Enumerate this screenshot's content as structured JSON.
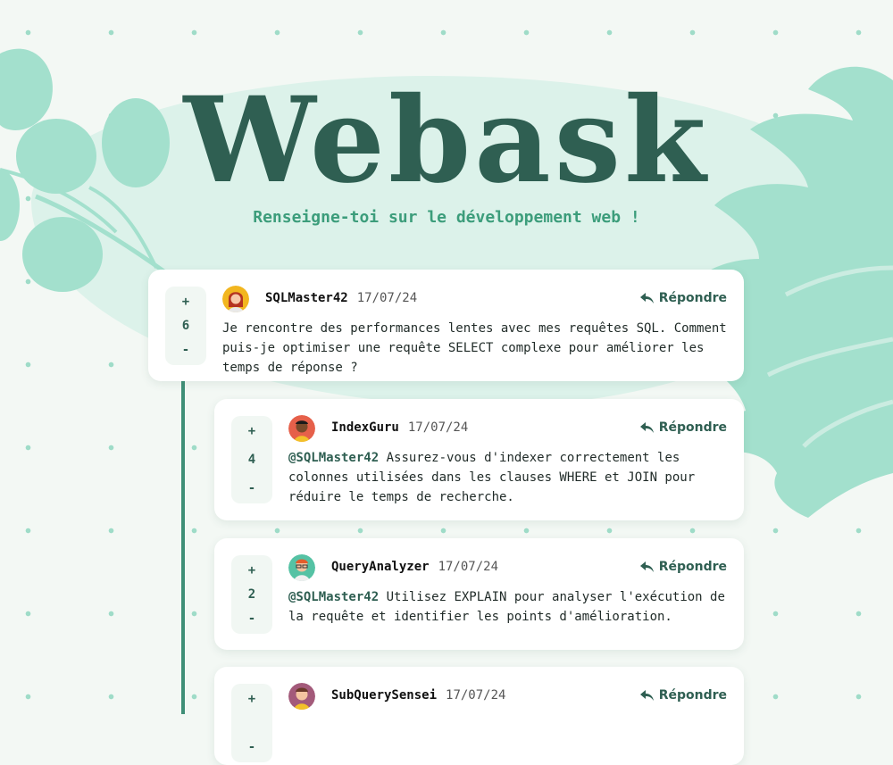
{
  "header": {
    "title": "Webask",
    "subtitle": "Renseigne-toi sur le développement web !"
  },
  "comments": [
    {
      "score": "6",
      "user": "SQLMaster42",
      "date": "17/07/24",
      "reply_label": "Répondre",
      "mention": "",
      "text": "Je rencontre des performances lentes avec mes requêtes SQL. Comment puis-je optimiser une requête SELECT complexe pour améliorer les temps de réponse ?"
    },
    {
      "score": "4",
      "user": "IndexGuru",
      "date": "17/07/24",
      "reply_label": "Répondre",
      "mention": "@SQLMaster42",
      "text": "Assurez-vous d'indexer correctement les colonnes utilisées dans les clauses WHERE et JOIN pour réduire le temps de recherche."
    },
    {
      "score": "2",
      "user": "QueryAnalyzer",
      "date": "17/07/24",
      "reply_label": "Répondre",
      "mention": "@SQLMaster42",
      "text": "Utilisez EXPLAIN pour analyser l'exécution de la requête et identifier les points d'amélioration."
    },
    {
      "score": "",
      "user": "SubQuerySensei",
      "date": "17/07/24",
      "reply_label": "Répondre",
      "mention": "",
      "text": ""
    }
  ],
  "vote": {
    "up": "+",
    "down": "-"
  },
  "colors": {
    "primary": "#2f5f52",
    "accent": "#3c9d7b",
    "leaf": "#9fdcc8",
    "blob": "#dcf2ea"
  }
}
